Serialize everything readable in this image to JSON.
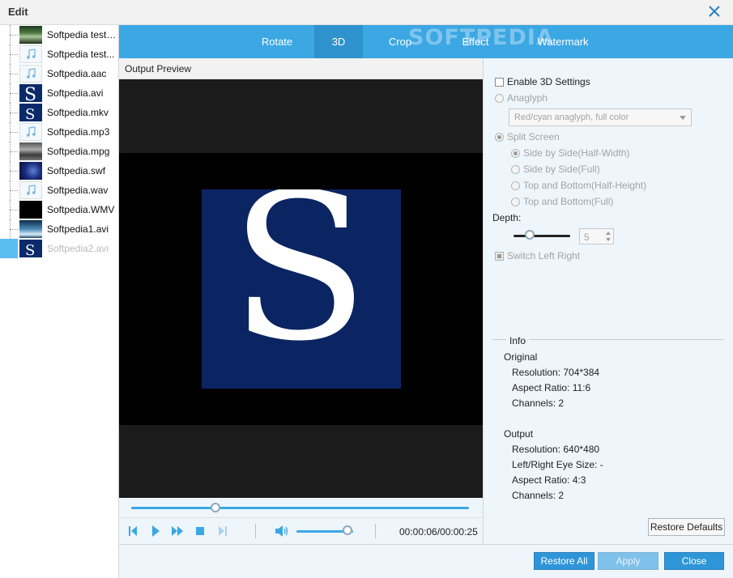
{
  "window": {
    "title": "Edit"
  },
  "files": [
    {
      "name": "Softpedia test ...",
      "thumb": "forest"
    },
    {
      "name": "Softpedia test...",
      "thumb": "music"
    },
    {
      "name": "Softpedia.aac",
      "thumb": "music"
    },
    {
      "name": "Softpedia.avi",
      "thumb": "sblue"
    },
    {
      "name": "Softpedia.mkv",
      "thumb": "sblue"
    },
    {
      "name": "Softpedia.mp3",
      "thumb": "music"
    },
    {
      "name": "Softpedia.mpg",
      "thumb": "city"
    },
    {
      "name": "Softpedia.swf",
      "thumb": "space"
    },
    {
      "name": "Softpedia.wav",
      "thumb": "music"
    },
    {
      "name": "Softpedia.WMV",
      "thumb": "black"
    },
    {
      "name": "Softpedia1.avi",
      "thumb": "soft1"
    },
    {
      "name": "Softpedia2.avi",
      "thumb": "sblue",
      "active": true
    }
  ],
  "tabs": {
    "rotate": "Rotate",
    "three_d": "3D",
    "crop": "Crop",
    "effect": "Effect",
    "watermark": "Watermark",
    "active": "3D"
  },
  "watermark_logo": "SOFTPEDIA",
  "preview": {
    "label": "Output Preview",
    "logo_letter": "S",
    "seek_position": 0.25,
    "volume": 0.9,
    "time_current": "00:00:06",
    "time_total": "00:00:25",
    "timecode": "00:00:06/00:00:25"
  },
  "settings3d": {
    "enable_label": "Enable 3D Settings",
    "enabled": false,
    "anaglyph_label": "Anaglyph",
    "anaglyph_selected": "Red/cyan anaglyph, full color",
    "split_label": "Split Screen",
    "split_options": [
      "Side by Side(Half-Width)",
      "Side by Side(Full)",
      "Top and Bottom(Half-Height)",
      "Top and Bottom(Full)"
    ],
    "split_selected_index": 0,
    "depth_label": "Depth:",
    "depth_value": "5",
    "switch_label": "Switch Left Right"
  },
  "info": {
    "title": "Info",
    "original_title": "Original",
    "original": {
      "resolution": "Resolution: 704*384",
      "aspect": "Aspect Ratio: 11:6",
      "channels": "Channels: 2"
    },
    "output_title": "Output",
    "output": {
      "resolution": "Resolution: 640*480",
      "eye_size": "Left/Right Eye Size: -",
      "aspect": "Aspect Ratio: 4:3",
      "channels": "Channels: 2"
    }
  },
  "buttons": {
    "restore_defaults": "Restore Defaults",
    "restore_all": "Restore All",
    "apply": "Apply",
    "close": "Close"
  },
  "colors": {
    "accent": "#3ba7e3",
    "accent_dark": "#2e92cc",
    "panel_bg": "#eef5fb",
    "selection": "#5bbcf0"
  }
}
